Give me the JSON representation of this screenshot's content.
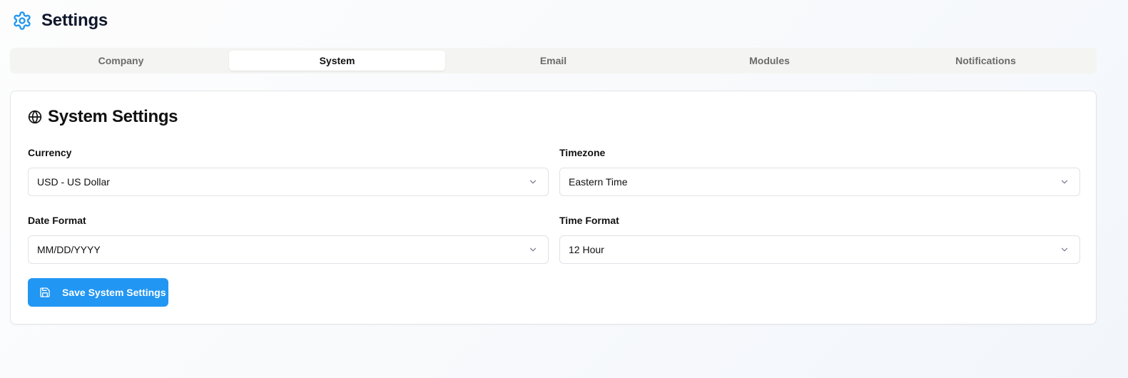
{
  "header": {
    "title": "Settings",
    "icon": "gear-icon",
    "icon_color": "#2196f3"
  },
  "tabs": [
    {
      "label": "Company",
      "active": false
    },
    {
      "label": "System",
      "active": true
    },
    {
      "label": "Email",
      "active": false
    },
    {
      "label": "Modules",
      "active": false
    },
    {
      "label": "Notifications",
      "active": false
    }
  ],
  "card": {
    "title": "System Settings",
    "icon": "globe-icon",
    "fields": {
      "currency": {
        "label": "Currency",
        "value": "USD - US Dollar"
      },
      "timezone": {
        "label": "Timezone",
        "value": "Eastern Time"
      },
      "date_format": {
        "label": "Date Format",
        "value": "MM/DD/YYYY"
      },
      "time_format": {
        "label": "Time Format",
        "value": "12 Hour"
      }
    },
    "save_button": {
      "label": "Save System Settings",
      "icon": "save-icon",
      "color": "#2196f3"
    }
  }
}
